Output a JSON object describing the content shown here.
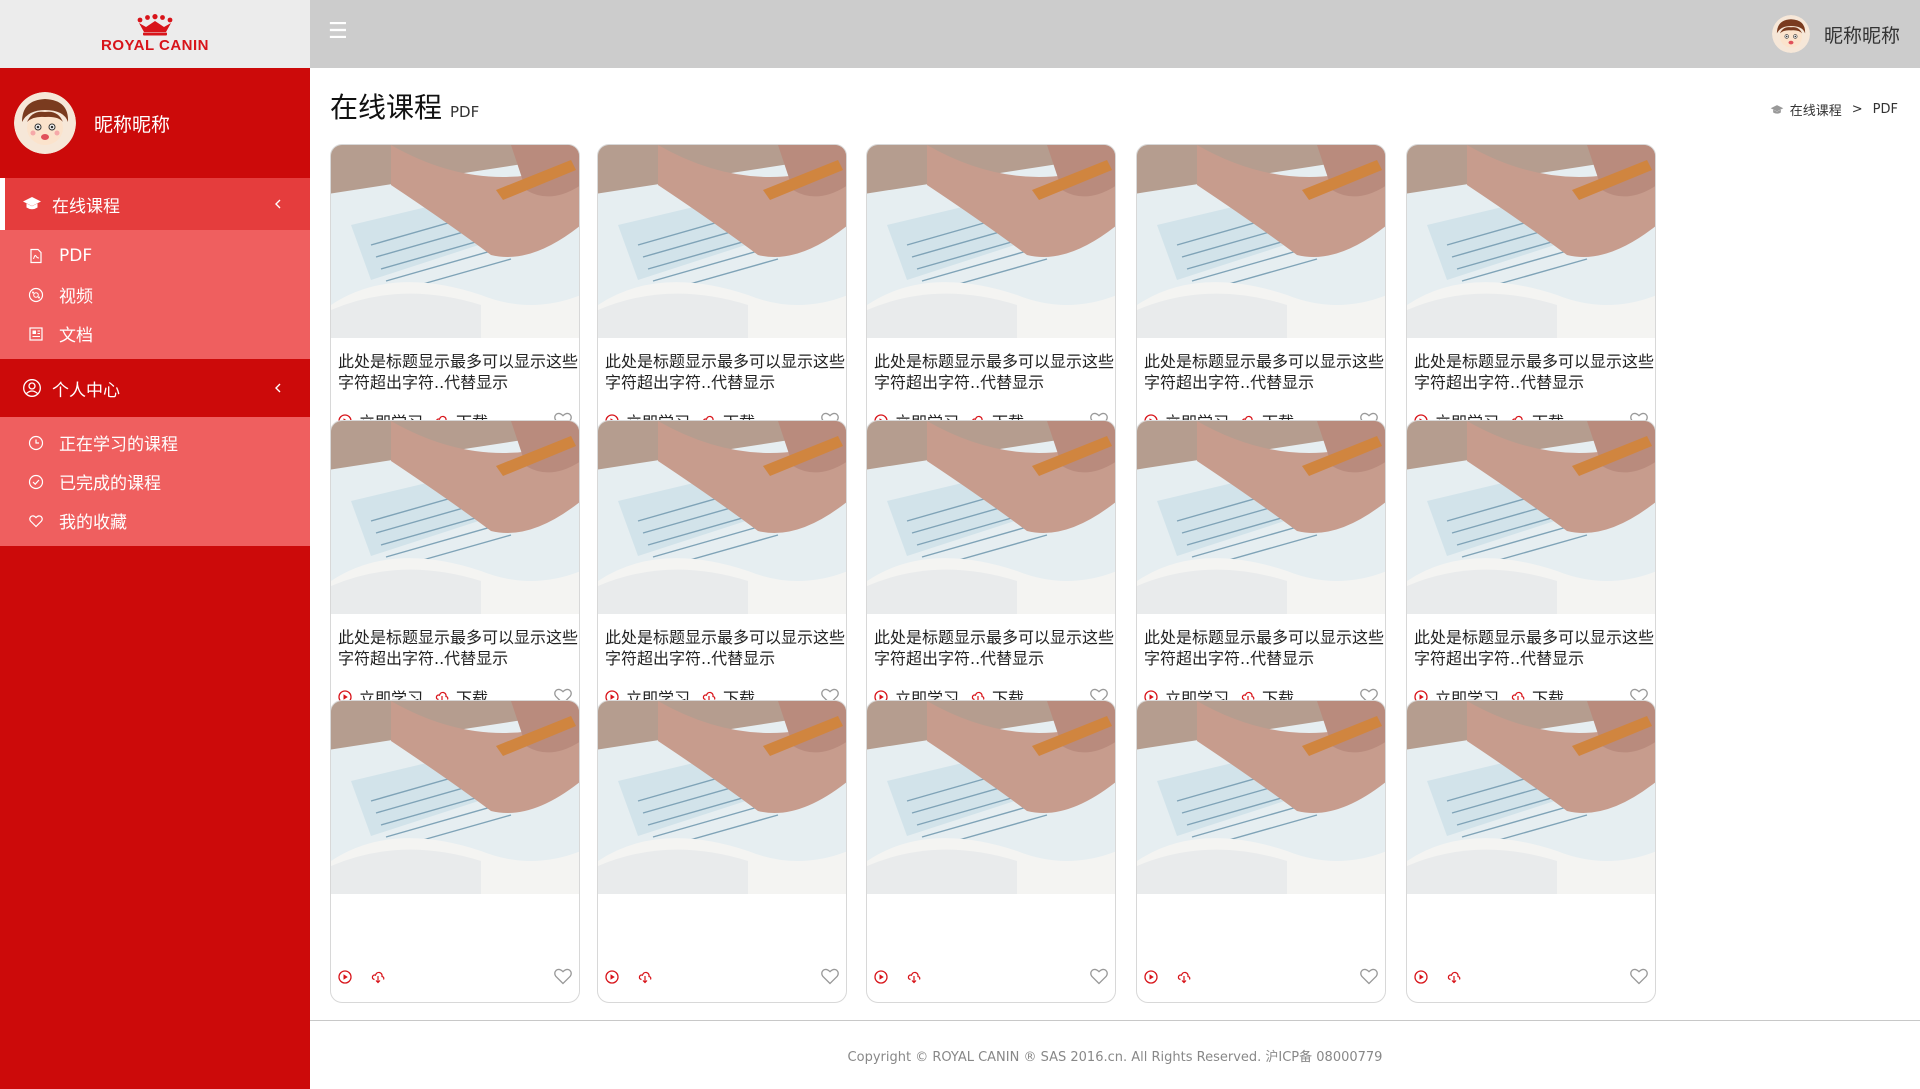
{
  "brand": {
    "logo_text": "ROYAL CANIN"
  },
  "user": {
    "nickname": "昵称昵称"
  },
  "sidebar": {
    "groups": [
      {
        "label": "在线课程",
        "icon": "graduation-cap-icon",
        "active": true,
        "items": [
          {
            "label": "PDF",
            "icon": "pdf-file-icon"
          },
          {
            "label": "视频",
            "icon": "video-icon"
          },
          {
            "label": "文档",
            "icon": "document-icon"
          }
        ]
      },
      {
        "label": "个人中心",
        "icon": "user-circle-icon",
        "active": false,
        "items": [
          {
            "label": "正在学习的课程",
            "icon": "clock-icon"
          },
          {
            "label": "已完成的课程",
            "icon": "check-circle-icon"
          },
          {
            "label": "我的收藏",
            "icon": "heart-icon"
          }
        ]
      }
    ]
  },
  "topbar": {
    "menu_icon": "hamburger-icon",
    "menu_glyph": "☰"
  },
  "page": {
    "title": "在线课程",
    "subtitle": "PDF"
  },
  "breadcrumb": {
    "items": [
      "在线课程",
      "PDF"
    ],
    "separator": ">"
  },
  "cards": [
    {
      "title": "此处是标题显示最多可以显示这些字符超出字符..代替显示",
      "study_label": "立即学习",
      "download_label": "下载"
    },
    {
      "title": "此处是标题显示最多可以显示这些字符超出字符..代替显示",
      "study_label": "立即学习",
      "download_label": "下载"
    },
    {
      "title": "此处是标题显示最多可以显示这些字符超出字符..代替显示",
      "study_label": "立即学习",
      "download_label": "下载"
    },
    {
      "title": "此处是标题显示最多可以显示这些字符超出字符..代替显示",
      "study_label": "立即学习",
      "download_label": "下载"
    },
    {
      "title": "此处是标题显示最多可以显示这些字符超出字符..代替显示",
      "study_label": "立即学习",
      "download_label": "下载"
    },
    {
      "title": "此处是标题显示最多可以显示这些字符超出字符..代替显示",
      "study_label": "立即学习",
      "download_label": "下载"
    },
    {
      "title": "此处是标题显示最多可以显示这些字符超出字符..代替显示",
      "study_label": "立即学习",
      "download_label": "下载"
    },
    {
      "title": "此处是标题显示最多可以显示这些字符超出字符..代替显示",
      "study_label": "立即学习",
      "download_label": "下载"
    },
    {
      "title": "此处是标题显示最多可以显示这些字符超出字符..代替显示",
      "study_label": "立即学习",
      "download_label": "下载"
    },
    {
      "title": "此处是标题显示最多可以显示这些字符超出字符..代替显示",
      "study_label": "立即学习",
      "download_label": "下载"
    },
    {
      "title": "",
      "study_label": "",
      "download_label": ""
    },
    {
      "title": "",
      "study_label": "",
      "download_label": ""
    },
    {
      "title": "",
      "study_label": "",
      "download_label": ""
    },
    {
      "title": "",
      "study_label": "",
      "download_label": ""
    },
    {
      "title": "",
      "study_label": "",
      "download_label": ""
    }
  ],
  "footer": {
    "copyright": "Copyright © ROYAL CANIN ® SAS 2016.cn. All Rights Reserved. 沪ICP备 08000779"
  },
  "colors": {
    "brand_red": "#cc0a0a",
    "submenu_red": "#ef5f5f",
    "active_red": "#e53d3d",
    "topbar_gray": "#cccccc",
    "icon_red": "#d8141a"
  }
}
